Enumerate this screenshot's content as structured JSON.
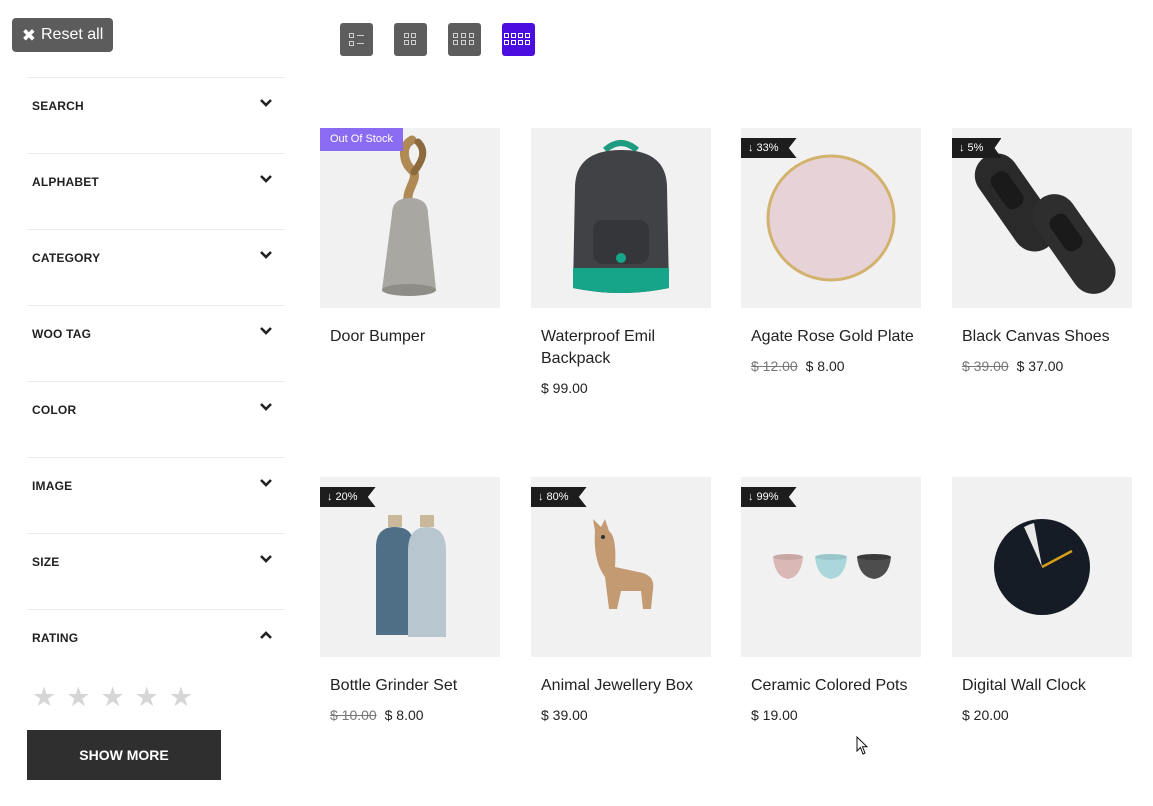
{
  "reset": {
    "label": "Reset all"
  },
  "layouts": [
    {
      "name": "list-layout"
    },
    {
      "name": "grid-2-layout"
    },
    {
      "name": "grid-3-layout"
    },
    {
      "name": "grid-4-layout",
      "active": true
    }
  ],
  "accent_color": "#4a0fe0",
  "filters": [
    {
      "label": "SEARCH",
      "expanded": false
    },
    {
      "label": "ALPHABET",
      "expanded": false
    },
    {
      "label": "CATEGORY",
      "expanded": false
    },
    {
      "label": "WOO TAG",
      "expanded": false
    },
    {
      "label": "COLOR",
      "expanded": false
    },
    {
      "label": "IMAGE",
      "expanded": false
    },
    {
      "label": "SIZE",
      "expanded": false
    },
    {
      "label": "RATING",
      "expanded": true
    }
  ],
  "rating": {
    "stars": [
      "★",
      "★",
      "★",
      "★",
      "★"
    ]
  },
  "show_more": {
    "label": "SHOW MORE"
  },
  "products": [
    {
      "name": "Door Bumper",
      "badge": "Out Of Stock",
      "badge_type": "oos",
      "old_price": "",
      "price": ""
    },
    {
      "name": "Waterproof Emil Backpack",
      "badge": "",
      "badge_type": "",
      "old_price": "",
      "price": "$ 99.00"
    },
    {
      "name": "Agate Rose Gold Plate",
      "badge": "↓ 33%",
      "badge_type": "disc",
      "old_price": "$ 12.00",
      "price": "$ 8.00"
    },
    {
      "name": "Black Canvas Shoes",
      "badge": "↓ 5%",
      "badge_type": "disc",
      "old_price": "$ 39.00",
      "price": "$ 37.00"
    },
    {
      "name": "Bottle Grinder Set",
      "badge": "↓ 20%",
      "badge_type": "disc",
      "old_price": "$ 10.00",
      "price": "$ 8.00"
    },
    {
      "name": "Animal Jewellery Box",
      "badge": "↓ 80%",
      "badge_type": "disc",
      "old_price": "",
      "price": "$ 39.00"
    },
    {
      "name": "Ceramic Colored Pots",
      "badge": "↓ 99%",
      "badge_type": "disc",
      "old_price": "",
      "price": "$ 19.00"
    },
    {
      "name": "Digital Wall Clock",
      "badge": "",
      "badge_type": "",
      "old_price": "",
      "price": "$ 20.00"
    }
  ]
}
